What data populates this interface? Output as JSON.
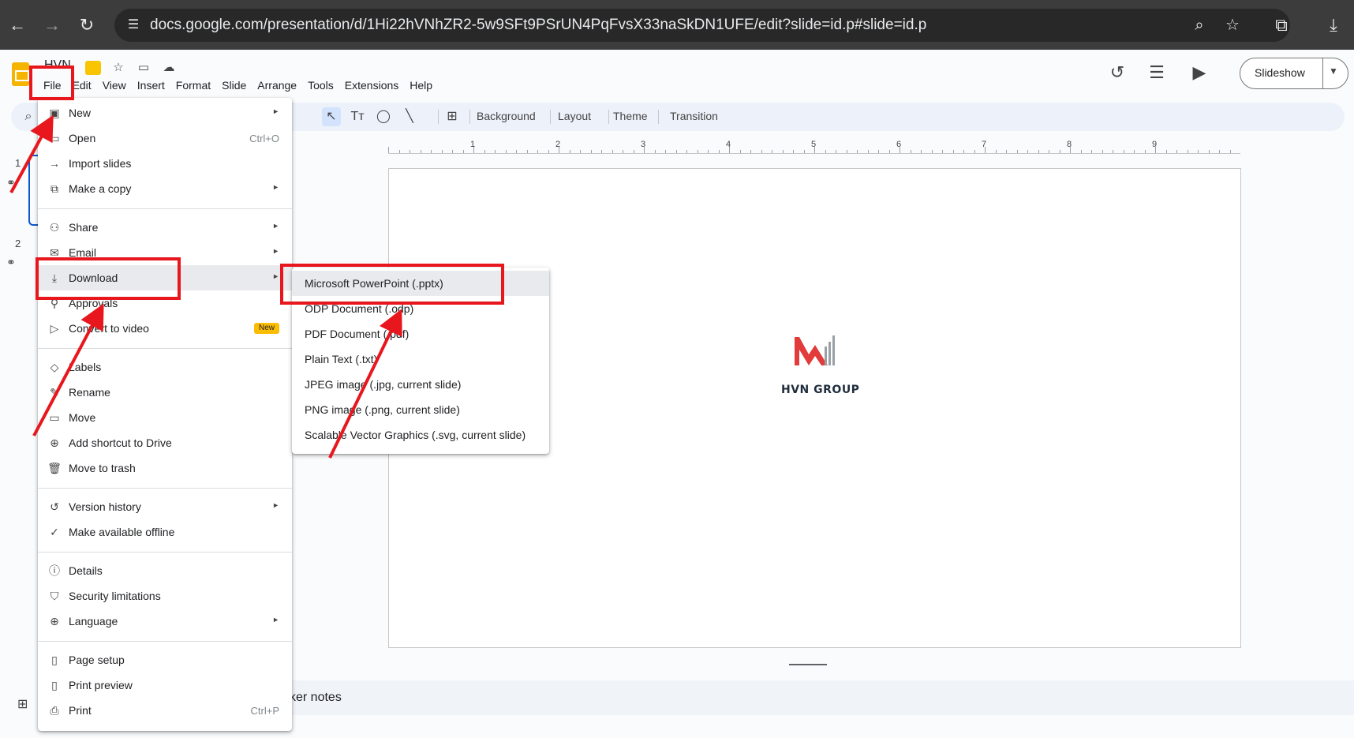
{
  "browser": {
    "url": "docs.google.com/presentation/d/1Hi22hVNhZR2-5w9SFt9PSrUN4PqFvsX33naSkDN1UFE/edit?slide=id.p#slide=id.p",
    "back_icon": "←",
    "forward_icon": "→",
    "reload_icon": "↻",
    "site_icon": "☰",
    "zoom_icon": "⌕",
    "star_icon": "☆",
    "extensions_icon": "⧉",
    "download_icon": "⤓"
  },
  "app": {
    "title": "HVN",
    "menus": [
      "File",
      "Edit",
      "View",
      "Insert",
      "Format",
      "Slide",
      "Arrange",
      "Tools",
      "Extensions",
      "Help"
    ],
    "slideshow_label": "Slideshow",
    "history_icon": "↺",
    "comment_icon": "☰",
    "camera_icon": "▶",
    "star_icon": "☆",
    "move_icon": "▭",
    "cloud_icon": "☁"
  },
  "toolbar": {
    "background_label": "Background",
    "layout_label": "Layout",
    "theme_label": "Theme",
    "transition_label": "Transition",
    "search_icon": "⌕",
    "select_icon": "↖",
    "textbox_icon": "Tт",
    "shape_icon": "◯",
    "line_icon": "╲",
    "comment_add_icon": "⊞"
  },
  "ruler": {
    "numbers": [
      "1",
      "2",
      "3",
      "4",
      "5",
      "6",
      "7",
      "8",
      "9"
    ]
  },
  "filmstrip": {
    "slide_numbers": [
      "1",
      "2"
    ]
  },
  "slide": {
    "logo_text": "HVN GROUP"
  },
  "notes": {
    "label": "ker notes"
  },
  "file_menu": {
    "items": [
      {
        "label": "New",
        "icon": "▣",
        "arrow": "►"
      },
      {
        "label": "Open",
        "icon": "▭",
        "shortcut": "Ctrl+O"
      },
      {
        "label": "Import slides",
        "icon": "→"
      },
      {
        "label": "Make a copy",
        "icon": "⧉",
        "arrow": "►"
      },
      {
        "label": "Share",
        "icon": "⚇",
        "arrow": "►"
      },
      {
        "label": "Email",
        "icon": "✉",
        "arrow": "►"
      },
      {
        "label": "Download",
        "icon": "⤓",
        "arrow": "►"
      },
      {
        "label": "Approvals",
        "icon": "⚲"
      },
      {
        "label": "Convert to video",
        "icon": "▷",
        "badge": "New"
      },
      {
        "label": "Labels",
        "icon": "◇"
      },
      {
        "label": "Rename",
        "icon": "✎"
      },
      {
        "label": "Move",
        "icon": "▭"
      },
      {
        "label": "Add shortcut to Drive",
        "icon": "⊕"
      },
      {
        "label": "Move to trash",
        "icon": "🗑"
      },
      {
        "label": "Version history",
        "icon": "↺",
        "arrow": "►"
      },
      {
        "label": "Make available offline",
        "icon": "✓"
      },
      {
        "label": "Details",
        "icon": "ⓘ"
      },
      {
        "label": "Security limitations",
        "icon": "⛉"
      },
      {
        "label": "Language",
        "icon": "⊕",
        "arrow": "►"
      },
      {
        "label": "Page setup",
        "icon": "▯"
      },
      {
        "label": "Print preview",
        "icon": "▯"
      },
      {
        "label": "Print",
        "icon": "⎙",
        "shortcut": "Ctrl+P"
      }
    ]
  },
  "download_menu": {
    "items": [
      "Microsoft PowerPoint (.pptx)",
      "ODP Document (.odp)",
      "PDF Document (.pdf)",
      "Plain Text (.txt)",
      "JPEG image (.jpg, current slide)",
      "PNG image (.png, current slide)",
      "Scalable Vector Graphics (.svg, current slide)"
    ]
  },
  "colors": {
    "annotation_red": "#e8161d",
    "accent_blue": "#0b57d0",
    "logo_red": "#e23b3b",
    "logo_gray": "#9aa0a6"
  },
  "grid_icon": "⊞"
}
